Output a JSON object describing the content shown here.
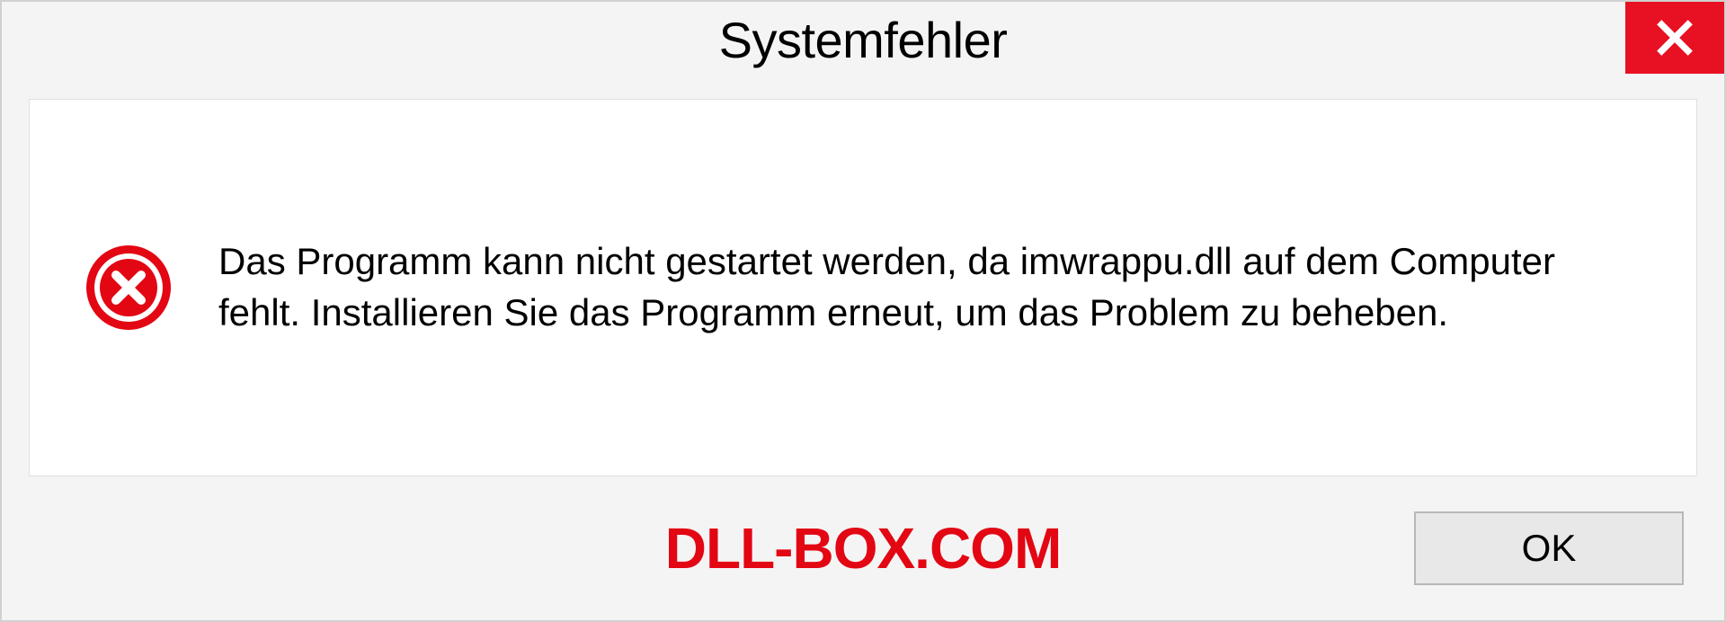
{
  "dialog": {
    "title": "Systemfehler",
    "message": "Das Programm kann nicht gestartet werden, da imwrappu.dll auf dem Computer fehlt. Installieren Sie das Programm erneut, um das Problem zu beheben.",
    "ok_label": "OK"
  },
  "watermark": "DLL-BOX.COM"
}
